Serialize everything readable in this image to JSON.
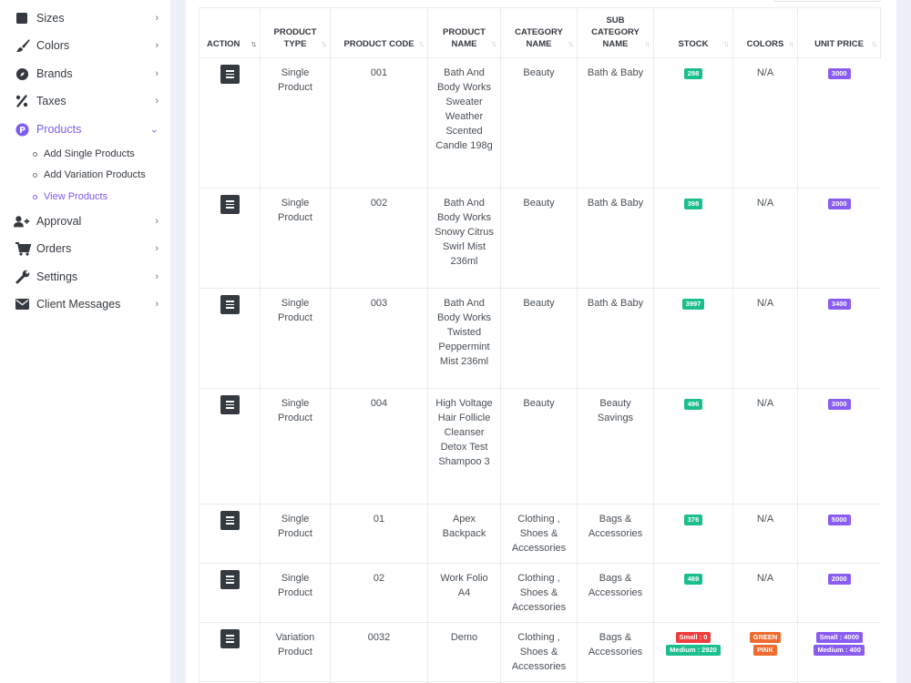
{
  "sidebar": {
    "items": [
      {
        "label": "Sizes",
        "icon": "square-icon"
      },
      {
        "label": "Colors",
        "icon": "brush-icon"
      },
      {
        "label": "Brands",
        "icon": "compass-icon"
      },
      {
        "label": "Taxes",
        "icon": "percent-icon"
      },
      {
        "label": "Products",
        "icon": "product-badge-icon"
      },
      {
        "label": "Approval",
        "icon": "user-plus-icon"
      },
      {
        "label": "Orders",
        "icon": "cart-icon"
      },
      {
        "label": "Settings",
        "icon": "wrench-icon"
      },
      {
        "label": "Client Messages",
        "icon": "envelope-icon"
      }
    ],
    "products_sub": [
      {
        "label": "Add Single Products"
      },
      {
        "label": "Add Variation Products"
      },
      {
        "label": "View Products"
      }
    ],
    "active_color": "#7c5cf0"
  },
  "table": {
    "headers": {
      "action": "Action",
      "product_type": "Product Type",
      "product_code": "Product Code",
      "product_name": "Product Name",
      "category_name": "Category Name",
      "sub_category_name": "Sub Category Name",
      "stock": "Stock",
      "colors": "Colors",
      "unit_price": "Unit Price"
    },
    "rows": [
      {
        "type": "Single Product",
        "code": "001",
        "name": "Bath And Body Works Sweater Weather Scented Candle 198g",
        "category": "Beauty",
        "sub_category": "Bath & Baby",
        "stock": "298",
        "colors": "N/A",
        "price": "3000"
      },
      {
        "type": "Single Product",
        "code": "002",
        "name": "Bath And Body Works Snowy Citrus Swirl Mist 236ml",
        "category": "Beauty",
        "sub_category": "Bath & Baby",
        "stock": "398",
        "colors": "N/A",
        "price": "2000"
      },
      {
        "type": "Single Product",
        "code": "003",
        "name": "Bath And Body Works Twisted Peppermint Mist 236ml",
        "category": "Beauty",
        "sub_category": "Bath & Baby",
        "stock": "3997",
        "colors": "N/A",
        "price": "3400"
      },
      {
        "type": "Single Product",
        "code": "004",
        "name": "High Voltage Hair Follicle Cleanser Detox Test Shampoo 3",
        "category": "Beauty",
        "sub_category": "Beauty Savings",
        "stock": "496",
        "colors": "N/A",
        "price": "3000"
      },
      {
        "type": "Single Product",
        "code": "01",
        "name": "Apex Backpack",
        "category": "Clothing , Shoes & Accessories",
        "sub_category": "Bags & Accessories",
        "stock": "376",
        "colors": "N/A",
        "price": "5000"
      },
      {
        "type": "Single Product",
        "code": "02",
        "name": "Work Folio A4",
        "category": "Clothing , Shoes & Accessories",
        "sub_category": "Bags & Accessories",
        "stock": "469",
        "colors": "N/A",
        "price": "2000"
      },
      {
        "type": "Variation Product",
        "code": "0032",
        "name": "Demo",
        "category": "Clothing , Shoes & Accessories",
        "sub_category": "Bags & Accessories",
        "stock_variants": [
          "Small : 0",
          "Medium : 2920"
        ],
        "color_variants": [
          "GREEN",
          "PINK"
        ],
        "price_variants": [
          "Small : 4000",
          "Medium : 400"
        ]
      }
    ]
  }
}
